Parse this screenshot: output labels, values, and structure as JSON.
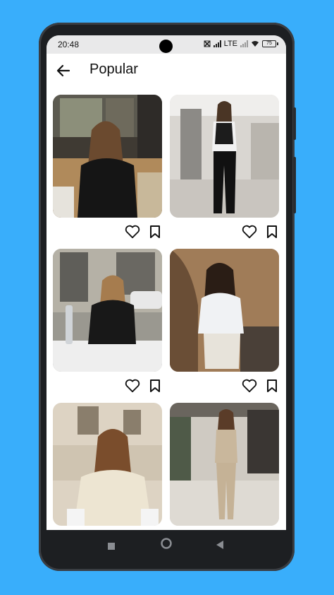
{
  "status": {
    "time": "20:48",
    "network": "LTE",
    "battery": "75"
  },
  "header": {
    "title": "Popular"
  },
  "photos": [
    {
      "id": "photo-1",
      "liked": false,
      "saved": false
    },
    {
      "id": "photo-2",
      "liked": false,
      "saved": false
    },
    {
      "id": "photo-3",
      "liked": false,
      "saved": false
    },
    {
      "id": "photo-4",
      "liked": false,
      "saved": false
    },
    {
      "id": "photo-5",
      "liked": false,
      "saved": false
    },
    {
      "id": "photo-6",
      "liked": false,
      "saved": false
    }
  ],
  "icons": {
    "back": "arrow-left-icon",
    "like": "heart-icon",
    "save": "bookmark-icon",
    "nav_recents": "square-icon",
    "nav_home": "circle-icon",
    "nav_back": "triangle-icon"
  },
  "colors": {
    "background": "#39aefb",
    "screen": "#ffffff",
    "statusbar": "#e9e9ea"
  }
}
